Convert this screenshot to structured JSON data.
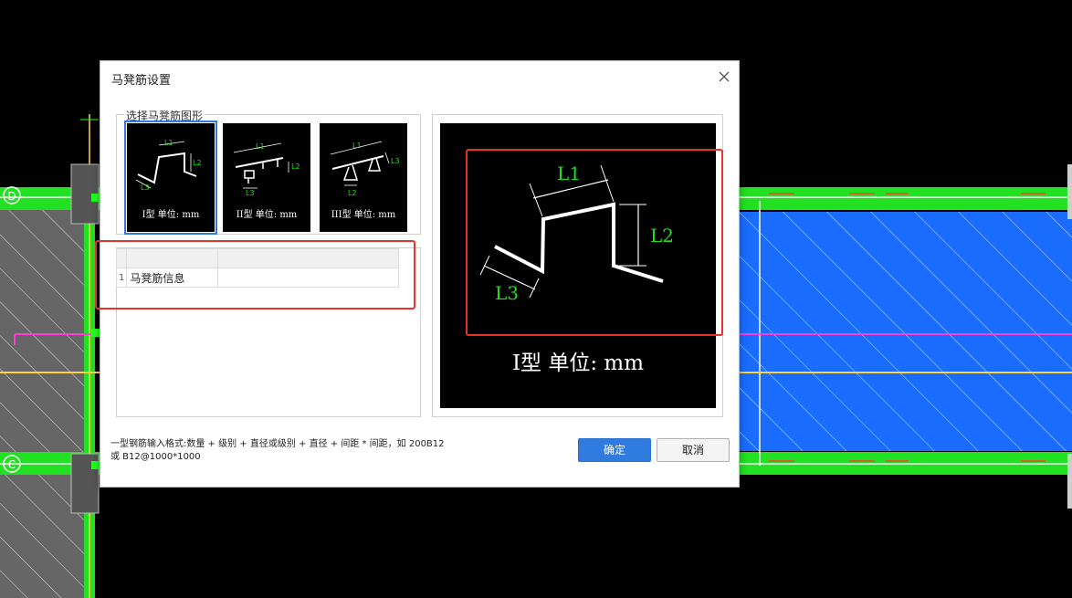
{
  "cad": {
    "axis_d": "D",
    "axis_c": "C"
  },
  "dialog": {
    "title": "马凳筋设置",
    "close_icon": "close-icon",
    "group_label": "选择马凳筋图形",
    "thumbnails": [
      {
        "caption": "I型 单位: mm",
        "labels": [
          "L1",
          "L2",
          "L3"
        ]
      },
      {
        "caption": "II型 单位: mm",
        "labels": [
          "L1",
          "L2",
          "L3"
        ]
      },
      {
        "caption": "III型 单位: mm",
        "labels": [
          "L1",
          "L3",
          "L2"
        ]
      }
    ],
    "table": {
      "rows": [
        {
          "index": "1",
          "name": "马凳筋信息",
          "value": ""
        }
      ]
    },
    "preview": {
      "caption": "I型 单位: mm",
      "labels": {
        "l1": "L1",
        "l2": "L2",
        "l3": "L3"
      }
    },
    "hint_line1": "一型钢筋输入格式:数量 + 级别 + 直径或级别 + 直径 + 间距 * 间距，如 200B12",
    "hint_line2": "或 B12@1000*1000",
    "ok_label": "确定",
    "cancel_label": "取消"
  },
  "colors": {
    "highlight_red": "#e8332a",
    "primary_blue": "#2f7be0",
    "label_green": "#22dd22",
    "cad_green": "#22e022",
    "cad_blue": "#1a6cff"
  }
}
